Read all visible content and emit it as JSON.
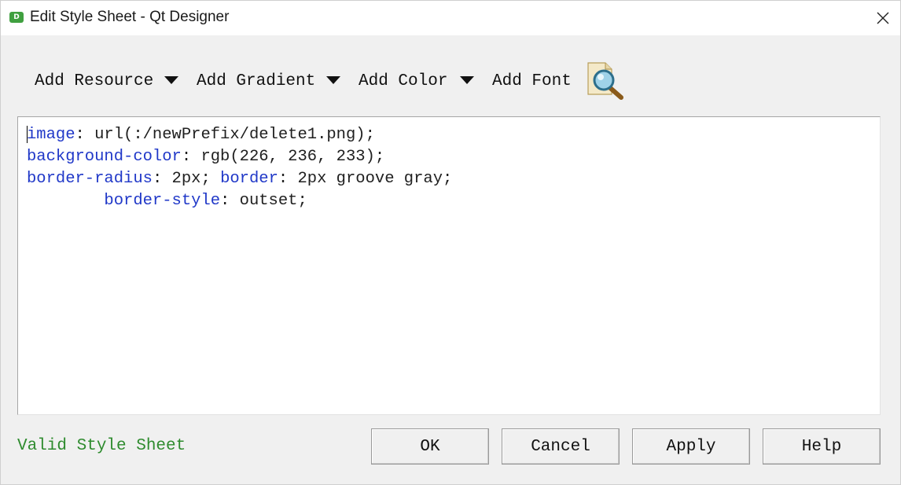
{
  "window": {
    "title": "Edit Style Sheet - Qt Designer",
    "app_icon_letter": "D",
    "close_icon": "close-icon"
  },
  "toolbar": {
    "add_resource": "Add Resource",
    "add_gradient": "Add Gradient",
    "add_color": "Add Color",
    "add_font": "Add Font",
    "find_icon": "find-icon"
  },
  "editor": {
    "lines": [
      {
        "indent": "",
        "segments": [
          {
            "text": "image",
            "type": "prop"
          },
          {
            "text": ": url(:/newPrefix/delete1.png);",
            "type": "value"
          }
        ]
      },
      {
        "indent": "",
        "segments": [
          {
            "text": "background-color",
            "type": "prop"
          },
          {
            "text": ": rgb(226, 236, 233);",
            "type": "value"
          }
        ]
      },
      {
        "indent": "",
        "segments": [
          {
            "text": "border-radius",
            "type": "prop"
          },
          {
            "text": ": 2px; ",
            "type": "value"
          },
          {
            "text": "border",
            "type": "prop"
          },
          {
            "text": ": 2px groove gray;",
            "type": "value"
          }
        ]
      },
      {
        "indent": "        ",
        "segments": [
          {
            "text": "border-style",
            "type": "prop"
          },
          {
            "text": ": outset;",
            "type": "value"
          }
        ]
      }
    ]
  },
  "status": {
    "text": "Valid Style Sheet",
    "color": "#2e8b2e"
  },
  "buttons": {
    "ok": "OK",
    "cancel": "Cancel",
    "apply": "Apply",
    "help": "Help"
  },
  "colors": {
    "property_blue": "#2038c8",
    "valid_green": "#2e8b2e"
  }
}
